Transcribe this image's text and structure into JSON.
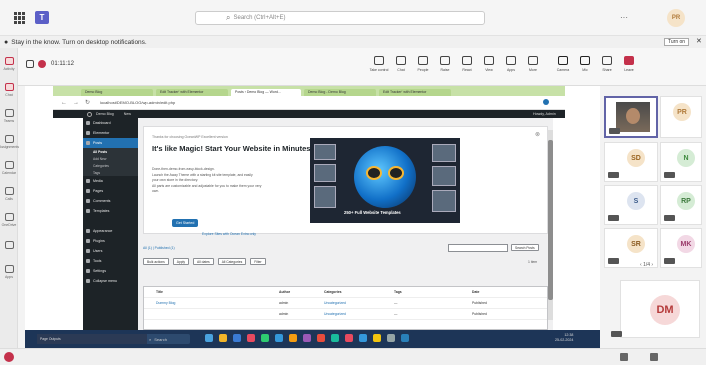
{
  "titlebar": {
    "search_placeholder": "Search (Ctrl+Alt+E)",
    "back_label": "",
    "user_initials": "PR"
  },
  "notification": {
    "text": "Stay in the know. Turn on desktop notifications.",
    "turn_on": "Turn on"
  },
  "rail": {
    "items": [
      {
        "label": "Activity",
        "icon": "bell-icon"
      },
      {
        "label": "Chat",
        "icon": "chat-icon"
      },
      {
        "label": "Teams",
        "icon": "teams-icon"
      },
      {
        "label": "Assignments",
        "icon": "assignments-icon"
      },
      {
        "label": "Calendar",
        "icon": "calendar-icon"
      },
      {
        "label": "Calls",
        "icon": "phone-icon"
      },
      {
        "label": "OneDrive",
        "icon": "cloud-icon"
      },
      {
        "label": "",
        "icon": "more-icon"
      },
      {
        "label": "Apps",
        "icon": "apps-icon"
      }
    ]
  },
  "meeting": {
    "timer": "01:11:12",
    "tools": [
      {
        "label": "Take control",
        "icon": "take-control-icon"
      },
      {
        "label": "Chat",
        "icon": "chat-icon"
      },
      {
        "label": "People",
        "icon": "people-icon"
      },
      {
        "label": "Raise",
        "icon": "raise-hand-icon"
      },
      {
        "label": "React",
        "icon": "react-icon"
      },
      {
        "label": "View",
        "icon": "view-icon"
      },
      {
        "label": "Apps",
        "icon": "apps-icon"
      },
      {
        "label": "More",
        "icon": "more-icon"
      },
      {
        "label": "Camera",
        "icon": "camera-icon"
      },
      {
        "label": "Mic",
        "icon": "mic-icon"
      },
      {
        "label": "Share",
        "icon": "share-icon"
      },
      {
        "label": "Leave",
        "icon": "leave-icon"
      }
    ]
  },
  "browser": {
    "tabs": [
      "Demo Blog",
      "Edit Tracker' with Elementor",
      "Posts ‹ Demo Blog — Word...",
      "Demo Blog - Demo Blog",
      "Edit Tracker' with Elementor"
    ],
    "address": "localhost/DEMO-BLOG/wp-admin/edit.php"
  },
  "wp": {
    "adminbar_site": "Demo Blog",
    "adminbar_new": "New",
    "adminbar_howdy": "Howdy, Admin",
    "menu": [
      {
        "label": "Dashboard",
        "current": false
      },
      {
        "label": "Elementor",
        "current": false
      },
      {
        "label": "Posts",
        "current": true
      }
    ],
    "submenu": [
      "All Posts",
      "Add New",
      "Categories",
      "Tags"
    ],
    "menu2": [
      {
        "label": "Media"
      },
      {
        "label": "Pages"
      },
      {
        "label": "Comments"
      },
      {
        "label": "Templates"
      },
      {
        "label": "Appearance"
      },
      {
        "label": "Plugins"
      },
      {
        "label": "Users"
      },
      {
        "label": "Tools"
      },
      {
        "label": "Settings"
      },
      {
        "label": "Collapse menu"
      }
    ],
    "flyout": [
      "All Pages",
      "Add New"
    ],
    "welcome": {
      "small": "Thanks for choosing OceanWP Excellent version",
      "heading": "It's like Magic! Start Your Website in Minutes",
      "p1": "Done-then-demo-from-easy-block-design.",
      "p2": "Launch the Away Theme with a starting kit site template, and easily",
      "p3": "your own store in the directory.",
      "p4": "All parts are customizable and adjustable for you to make them your very",
      "p5": "own.",
      "button": "Get Started",
      "link": "Explore Sites with Ocean Extra only",
      "banner": "250+ Full Website Templates"
    },
    "filters": {
      "counts": "All (1) | Published (1)",
      "bulk": "Bulk actions",
      "apply": "Apply",
      "dates": "All dates",
      "cats": "All Categories",
      "filter": "Filter",
      "search_btn": "Search Posts",
      "items": "1 item"
    },
    "table": {
      "headers": [
        "Title",
        "Author",
        "Categories",
        "Tags",
        "",
        "Date"
      ],
      "rows": [
        [
          "Dummy Blog",
          "admin",
          "Uncategorized",
          "—",
          "",
          "Published"
        ],
        [
          "",
          "admin",
          "Uncategorized",
          "—",
          "",
          "Published"
        ]
      ]
    }
  },
  "taskbar": {
    "statusbar": "Page Outputs",
    "search": "Search",
    "time": "12:38",
    "date": "25-02-2024"
  },
  "participants": [
    {
      "initials": "PR",
      "color": "#f5e3c8",
      "text": "#b07a3a"
    },
    {
      "initials": "SD",
      "color": "#f5e3c8",
      "text": "#9a6420"
    },
    {
      "initials": "N",
      "color": "#d5ecd5",
      "text": "#3d8a3d"
    },
    {
      "initials": "S",
      "color": "#dde4f0",
      "text": "#3a5a8a"
    },
    {
      "initials": "RP",
      "color": "#d5ecd5",
      "text": "#3d7a3d"
    },
    {
      "initials": "SR",
      "color": "#f5e3c8",
      "text": "#8a5a20"
    },
    {
      "initials": "MK",
      "color": "#f2d8e5",
      "text": "#9a3a6a"
    },
    {
      "initials": "DM",
      "color": "#f6d8d8",
      "text": "#b53a3a"
    }
  ],
  "pager": "1/4",
  "colors": {
    "teams_purple": "#5b5fc7",
    "wp_blue": "#2271b1",
    "wp_dark": "#1d2327",
    "leave_red": "#c4314b"
  }
}
